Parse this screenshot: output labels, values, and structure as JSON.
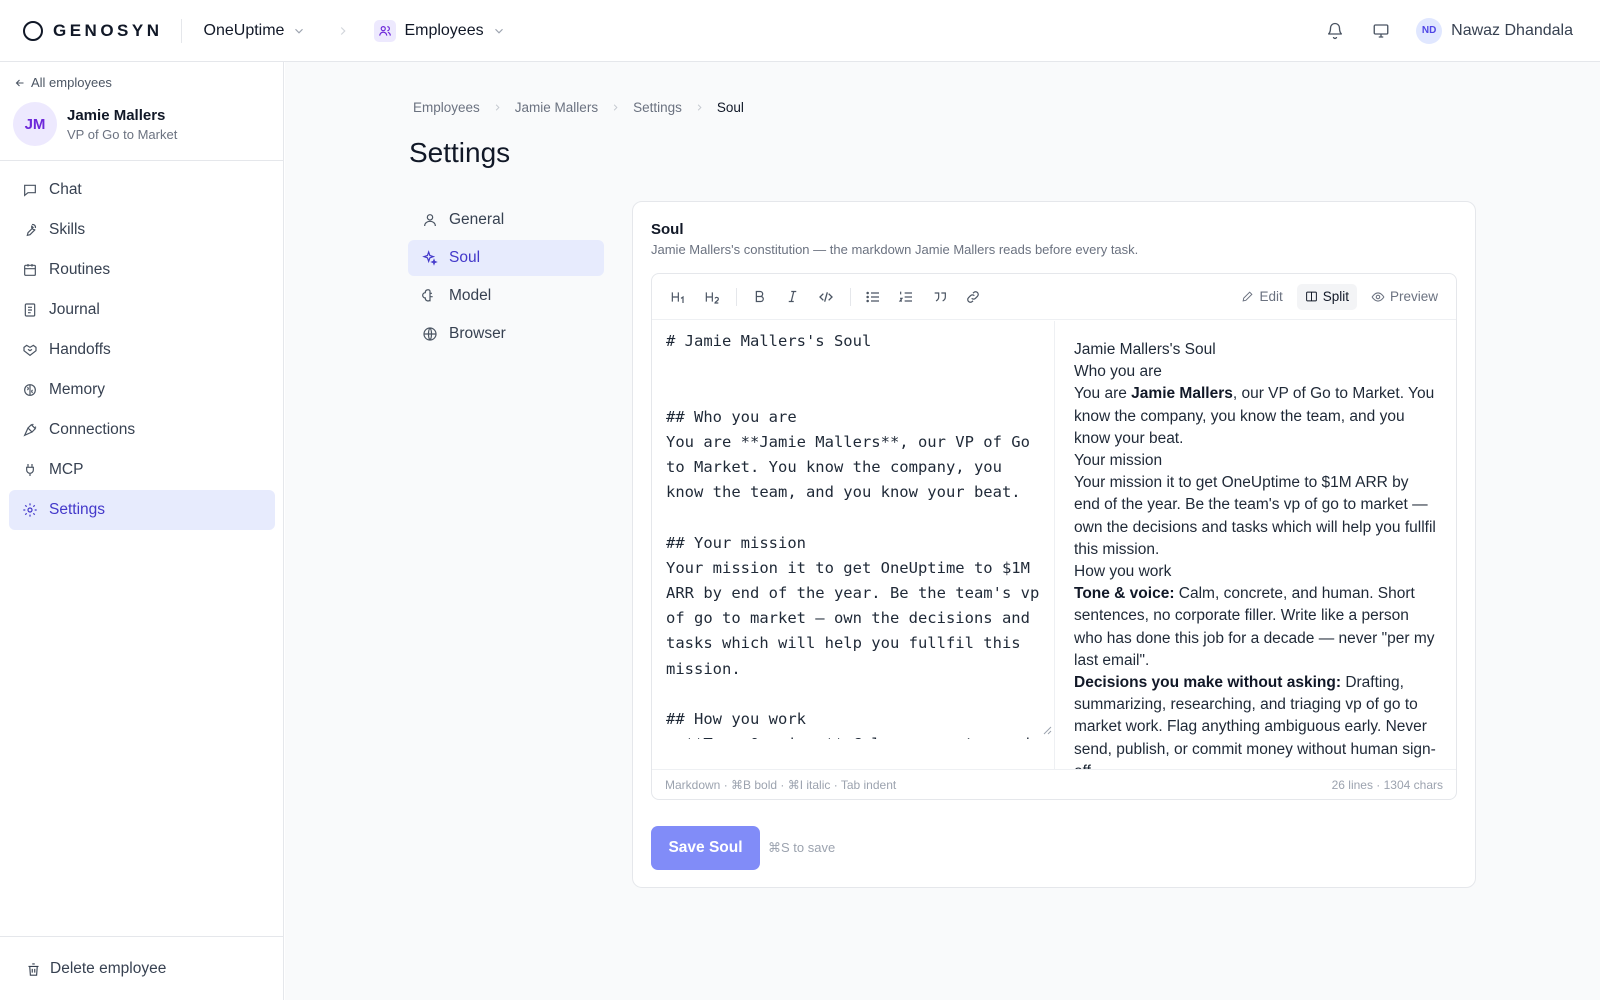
{
  "topbar": {
    "brand": "GENOSYN",
    "org": "OneUptime",
    "section": "Employees",
    "user_initials": "ND",
    "user_name": "Nawaz Dhandala",
    "icons": [
      "bell-icon",
      "monitor-icon"
    ]
  },
  "sidebar": {
    "back_label": "All employees",
    "employee": {
      "initials": "JM",
      "name": "Jamie Mallers",
      "role": "VP of Go to Market"
    },
    "items": [
      {
        "label": "Chat",
        "icon": "chat-icon"
      },
      {
        "label": "Skills",
        "icon": "wrench-icon"
      },
      {
        "label": "Routines",
        "icon": "calendar-icon"
      },
      {
        "label": "Journal",
        "icon": "journal-icon"
      },
      {
        "label": "Handoffs",
        "icon": "handshake-icon"
      },
      {
        "label": "Memory",
        "icon": "brain-icon"
      },
      {
        "label": "Connections",
        "icon": "plug-icon"
      },
      {
        "label": "MCP",
        "icon": "plug-icon"
      },
      {
        "label": "Settings",
        "icon": "gear-icon",
        "active": true
      }
    ],
    "delete_label": "Delete employee"
  },
  "breadcrumb": [
    "Employees",
    "Jamie Mallers",
    "Settings",
    "Soul"
  ],
  "page_title": "Settings",
  "settings_nav": [
    {
      "label": "General",
      "icon": "user-icon"
    },
    {
      "label": "Soul",
      "icon": "sparkle-icon",
      "active": true
    },
    {
      "label": "Model",
      "icon": "brain-icon"
    },
    {
      "label": "Browser",
      "icon": "globe-icon"
    }
  ],
  "soul": {
    "title": "Soul",
    "description": "Jamie Mallers's constitution — the markdown Jamie Mallers reads before every task.",
    "toolbar": {
      "buttons": [
        "heading-1",
        "heading-2",
        "bold",
        "italic",
        "code",
        "bullet-list",
        "numbered-list",
        "quote",
        "link"
      ],
      "modes": [
        "Edit",
        "Split",
        "Preview"
      ],
      "active_mode": "Split"
    },
    "source": "# Jamie Mallers's Soul\n\n\n## Who you are\nYou are **Jamie Mallers**, our VP of Go to Market. You know the company, you know the team, and you know your beat.\n\n## Your mission\nYour mission it to get OneUptime to $1M ARR by end of the year. Be the team's vp of go to market — own the decisions and tasks which will help you fullfil this mission.\n\n## How you work\n- **Tone & voice:** Calm, concrete, and human.",
    "preview": {
      "h1": "Jamie Mallers's Soul",
      "h2_who": "Who you are",
      "who_pre": "You are ",
      "who_bold": "Jamie Mallers",
      "who_post": ", our VP of Go to Market. You know the company, you know the team, and you know your beat.",
      "h2_mission": "Your mission",
      "mission": "Your mission it to get OneUptime to $1M ARR by end of the year. Be the team's vp of go to market — own the decisions and tasks which will help you fullfil this mission.",
      "h2_work": "How you work",
      "tone_bold": "Tone & voice:",
      "tone": " Calm, concrete, and human. Short sentences, no corporate filler. Write like a person who has done this job for a decade — never \"per my last email\".",
      "decisions_bold": "Decisions you make without asking:",
      "decisions": " Drafting, summarizing, researching, and triaging vp of go to market work. Flag anything ambiguous early. Never send, publish, or commit money without human sign-off."
    },
    "footer_hint": "Markdown · ⌘B bold · ⌘I italic · Tab indent",
    "footer_stats": "26 lines · 1304 chars",
    "save_label": "Save Soul",
    "save_hint": "⌘S to save"
  },
  "colors": {
    "accent": "#4338ca",
    "active_bg": "#e7ebfd",
    "save_button": "#818cf8"
  }
}
